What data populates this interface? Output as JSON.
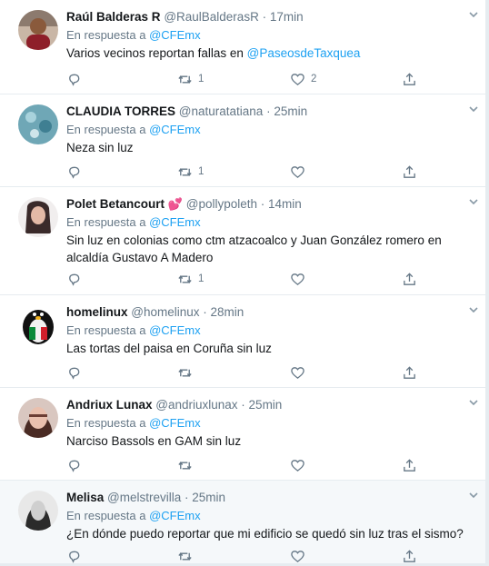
{
  "reply_prefix": "En respuesta a",
  "tweets": [
    {
      "name": "Raúl Balderas R",
      "handle": "@RaulBalderasR",
      "time": "17min",
      "reply_to": "@CFEmx",
      "text_before": "Varios vecinos reportan fallas en ",
      "text_mention": "@PaseosdeTaxquea",
      "text_after": "",
      "retweets": "1",
      "likes": "2"
    },
    {
      "name": "CLAUDIA TORRES",
      "handle": "@naturatatiana",
      "time": "25min",
      "reply_to": "@CFEmx",
      "text_before": "Neza sin luz",
      "text_mention": "",
      "text_after": "",
      "retweets": "1",
      "likes": ""
    },
    {
      "name": "Polet Betancourt",
      "name_emoji": "💕",
      "handle": "@pollypoleth",
      "time": "14min",
      "reply_to": "@CFEmx",
      "text_before": "Sin luz en colonias como ctm atzacoalco y Juan González romero en alcaldía Gustavo A Madero",
      "text_mention": "",
      "text_after": "",
      "retweets": "1",
      "likes": ""
    },
    {
      "name": "homelinux",
      "handle": "@homelinux",
      "time": "28min",
      "reply_to": "@CFEmx",
      "text_before": "Las tortas del paisa en Coruña sin luz",
      "text_mention": "",
      "text_after": "",
      "retweets": "",
      "likes": ""
    },
    {
      "name": "Andriux Lunax",
      "handle": "@andriuxlunax",
      "time": "25min",
      "reply_to": "@CFEmx",
      "text_before": "Narciso Bassols en GAM sin luz",
      "text_mention": "",
      "text_after": "",
      "retweets": "",
      "likes": ""
    },
    {
      "name": "Melisa",
      "handle": "@melstrevilla",
      "time": "25min",
      "reply_to": "@CFEmx",
      "text_before": "¿En dónde puedo reportar que mi edificio se quedó sin luz tras el sismo?",
      "text_mention": "",
      "text_after": "",
      "retweets": "",
      "likes": ""
    }
  ],
  "colors": {
    "accent": "#1da1f2",
    "meta": "#657786",
    "border": "#e6ecf0",
    "heart": "#e0245e"
  },
  "icons": [
    "chevron-down-icon",
    "reply-icon",
    "retweet-icon",
    "like-icon",
    "share-icon"
  ]
}
